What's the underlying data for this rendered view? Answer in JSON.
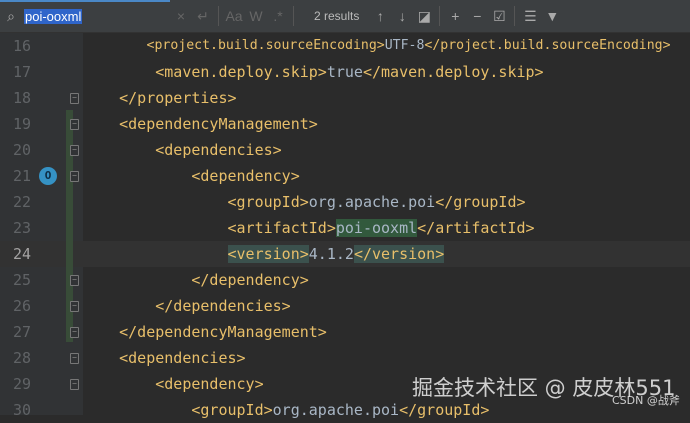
{
  "search": {
    "query": "poi-ooxml",
    "results": "2 results",
    "match_case": "Aa",
    "words": "W",
    "regex": ".*"
  },
  "lines": [
    {
      "n": "16",
      "code": [
        [
          "t",
          "        <project.build.sourceEncoding>"
        ],
        [
          "",
          "UTF-8"
        ],
        [
          "t",
          "</project.build.sourceEncoding>"
        ]
      ]
    },
    {
      "n": "17",
      "code": [
        [
          "t",
          "        <maven.deploy.skip>"
        ],
        [
          "",
          "true"
        ],
        [
          "t",
          "</maven.deploy.skip>"
        ]
      ]
    },
    {
      "n": "18",
      "code": [
        [
          "t",
          "    </properties>"
        ]
      ]
    },
    {
      "n": "19",
      "code": [
        [
          "t",
          "    <dependencyManagement>"
        ]
      ]
    },
    {
      "n": "20",
      "code": [
        [
          "t",
          "        <dependencies>"
        ]
      ]
    },
    {
      "n": "21",
      "code": [
        [
          "t",
          "            <dependency>"
        ]
      ]
    },
    {
      "n": "22",
      "code": [
        [
          "t",
          "                <groupId>"
        ],
        [
          "",
          "org.apache.poi"
        ],
        [
          "t",
          "</groupId>"
        ]
      ]
    },
    {
      "n": "23",
      "code": [
        [
          "t",
          "                <artifactId>"
        ],
        [
          "m",
          "poi-ooxml"
        ],
        [
          "t",
          "</artifactId>"
        ]
      ]
    },
    {
      "n": "24",
      "code": [
        [
          "",
          "                "
        ],
        [
          "tb",
          "<version>"
        ],
        [
          "",
          "4.1.2"
        ],
        [
          "tb",
          "</version>"
        ]
      ]
    },
    {
      "n": "25",
      "code": [
        [
          "t",
          "            </dependency>"
        ]
      ]
    },
    {
      "n": "26",
      "code": [
        [
          "t",
          "        </dependencies>"
        ]
      ]
    },
    {
      "n": "27",
      "code": [
        [
          "t",
          "    </dependencyManagement>"
        ]
      ]
    },
    {
      "n": "28",
      "code": [
        [
          "t",
          "    <dependencies>"
        ]
      ]
    },
    {
      "n": "29",
      "code": [
        [
          "t",
          "        <dependency>"
        ]
      ]
    },
    {
      "n": "30",
      "code": [
        [
          "t",
          "            <groupId>"
        ],
        [
          "",
          "org.apache.poi"
        ],
        [
          "t",
          "</groupId>"
        ]
      ]
    }
  ],
  "watermark": {
    "main": "掘金技术社区 @ 皮皮林551",
    "sub": "CSDN @战斧"
  }
}
